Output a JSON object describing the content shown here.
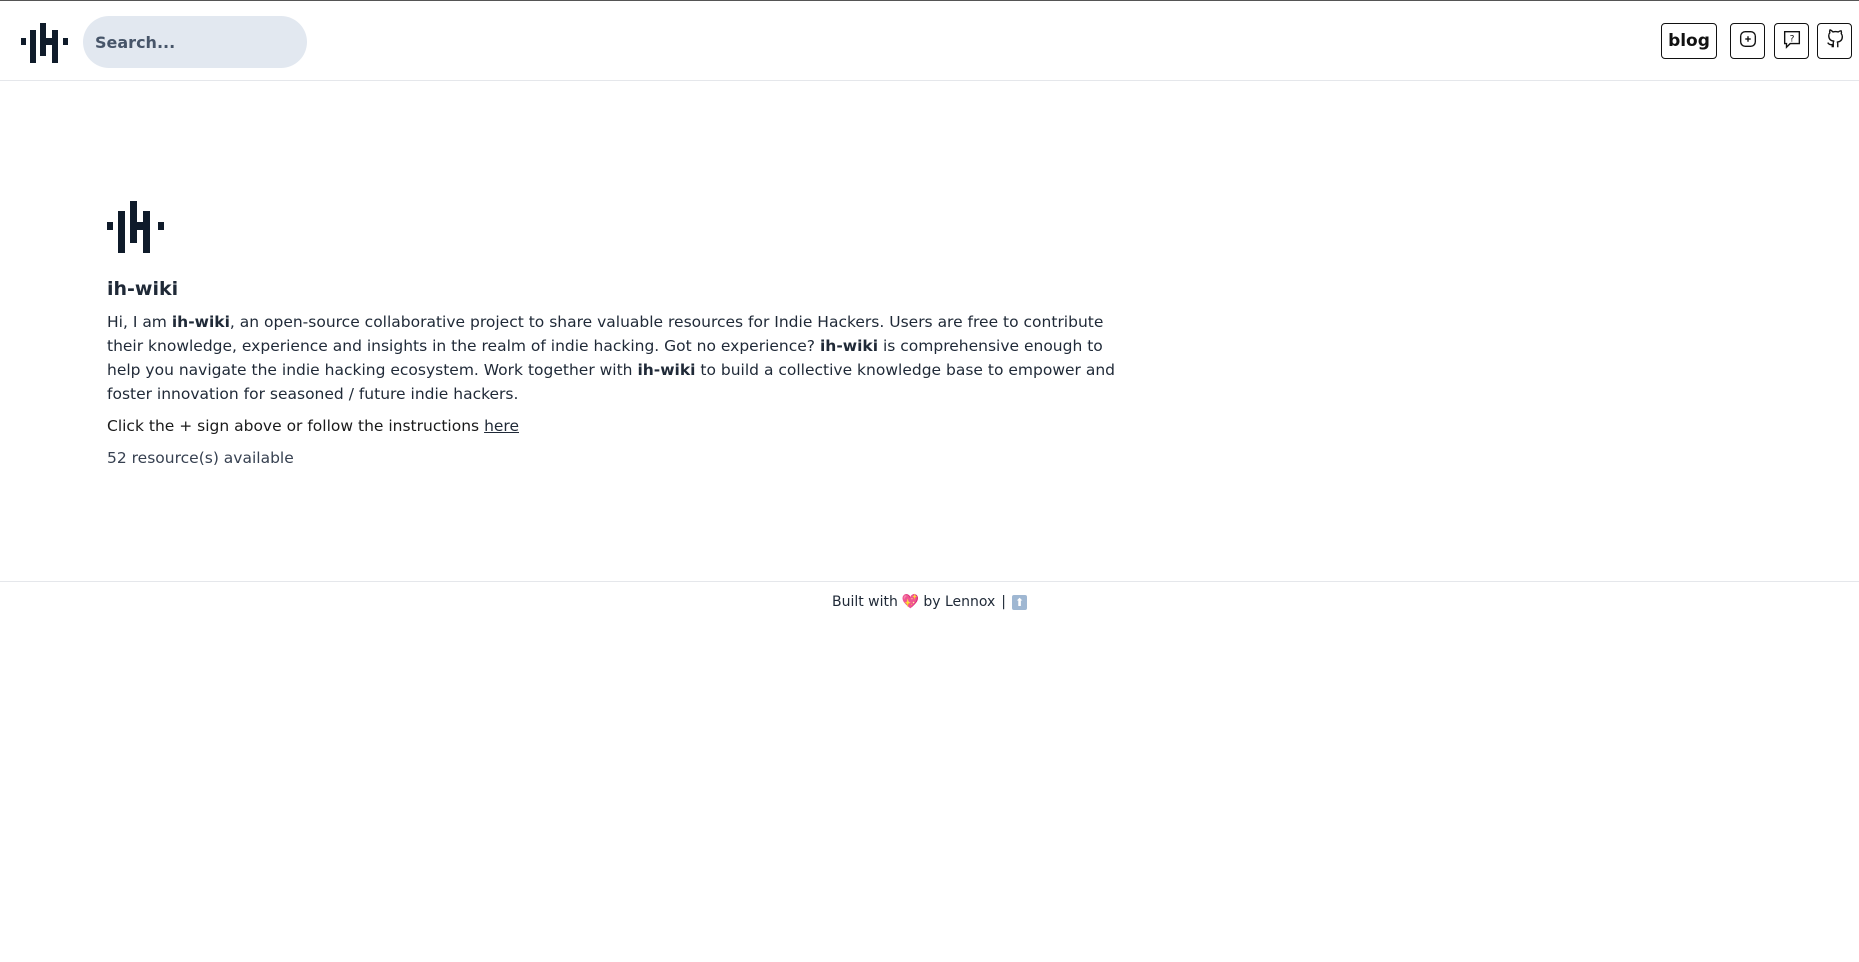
{
  "header": {
    "search_placeholder": "Search...",
    "blog_label": "blog",
    "icons": [
      "logo-icon",
      "add-icon",
      "help-icon",
      "github-icon"
    ]
  },
  "main": {
    "title": "ih-wiki",
    "intro": {
      "part1": "Hi, I am ",
      "name1": "ih-wiki",
      "part2": ", an open-source collaborative project to share valuable resources for Indie Hackers. Users are free to contribute their knowledge, experience and insights in the realm of indie hacking. Got no experience? ",
      "name2": "ih-wiki",
      "part3": " is comprehensive enough to help you navigate the indie hacking ecosystem. Work together with ",
      "name3": "ih-wiki",
      "part4": " to build a collective knowledge base to empower and foster innovation for seasoned / future indie hackers."
    },
    "instructions_text": "Click the + sign above or follow the instructions ",
    "instructions_link": "here",
    "resource_count": "52 resource(s) available"
  },
  "footer": {
    "built_with": "Built with",
    "heart": "💖",
    "by": "by Lennox",
    "separator": "|",
    "back_to_top": "⬆"
  },
  "colors": {
    "logo": "#0f1b2a",
    "search_bg": "#e2e8f0",
    "border": "#e5e7eb"
  }
}
